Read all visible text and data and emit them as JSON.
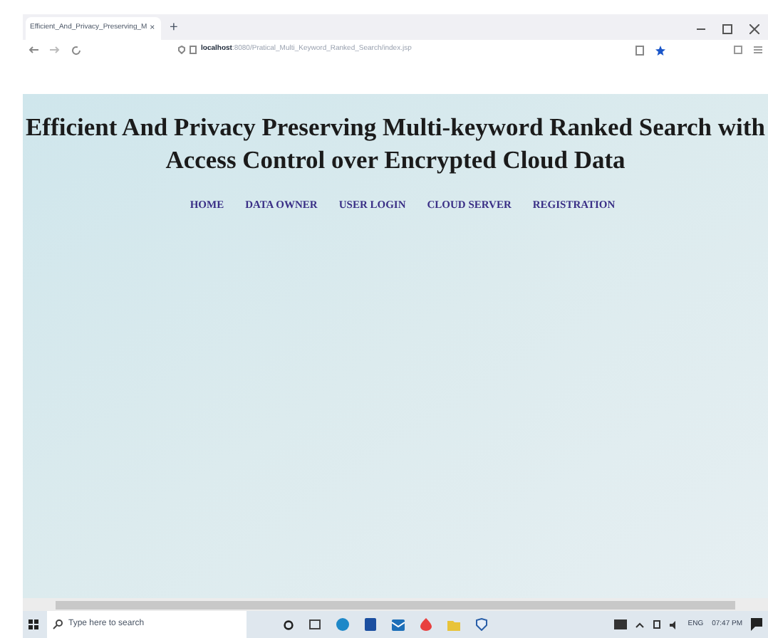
{
  "browser": {
    "tab_title": "Efficient_And_Privacy_Preserving_M",
    "tab_close": "×",
    "new_tab": "+",
    "url_host": "localhost",
    "url_path": ":8080/Pratical_Multi_Keyword_Ranked_Search/index.jsp"
  },
  "page": {
    "title": "Efficient And Privacy Preserving Multi-keyword Ranked Search with Access Control over Encrypted Cloud Data",
    "nav": [
      {
        "label": "HOME"
      },
      {
        "label": "DATA OWNER"
      },
      {
        "label": "USER LOGIN"
      },
      {
        "label": "CLOUD SERVER"
      },
      {
        "label": "REGISTRATION"
      }
    ]
  },
  "taskbar": {
    "search_placeholder": "Type here to search",
    "language": "ENG",
    "time": "07:47 PM"
  }
}
